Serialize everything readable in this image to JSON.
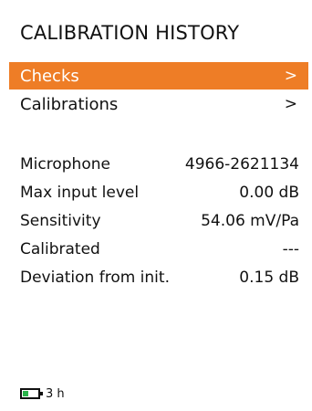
{
  "header": {
    "title": "CALIBRATION HISTORY"
  },
  "menu": {
    "items": [
      {
        "label": "Checks",
        "arrow": ">",
        "selected": true
      },
      {
        "label": "Calibrations",
        "arrow": ">",
        "selected": false
      }
    ]
  },
  "details": {
    "rows": [
      {
        "label": "Microphone",
        "value": "4966-2621134"
      },
      {
        "label": "Max input level",
        "value": "0.00 dB"
      },
      {
        "label": "Sensitivity",
        "value": "54.06 mV/Pa"
      },
      {
        "label": "Calibrated",
        "value": "---"
      },
      {
        "label": "Deviation from init.",
        "value": "0.15 dB"
      }
    ]
  },
  "status": {
    "battery_icon": "battery-icon",
    "battery_time": "3 h",
    "colors": {
      "accent": "#ee7d26",
      "battery": "#29b34a"
    }
  }
}
